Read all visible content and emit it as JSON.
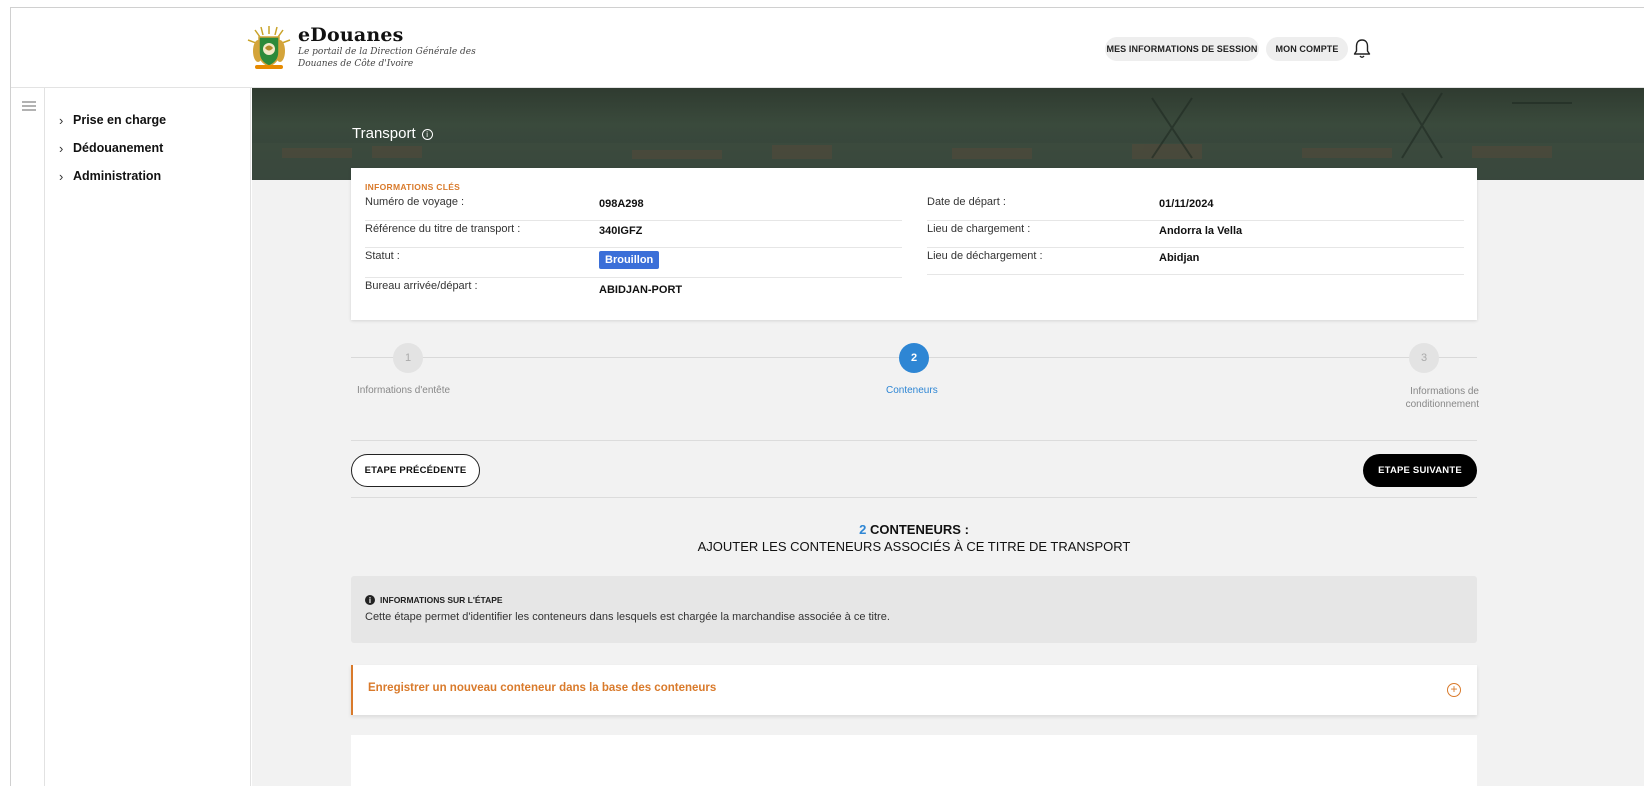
{
  "brand": {
    "name": "eDouanes",
    "tagline": "Le portail de la Direction Générale des Douanes de Côte d'Ivoire"
  },
  "header": {
    "session_label": "MES INFORMATIONS DE SESSION",
    "account_label": "MON COMPTE"
  },
  "sidebar": {
    "items": [
      {
        "label": "Prise en charge"
      },
      {
        "label": "Dédouanement"
      },
      {
        "label": "Administration"
      }
    ]
  },
  "page": {
    "title": "Transport"
  },
  "key_info": {
    "heading": "INFORMATIONS CLÉS",
    "left": [
      {
        "label": "Numéro de voyage :",
        "value": "098A298"
      },
      {
        "label": "Référence du titre de transport :",
        "value": "340IGFZ"
      },
      {
        "label": "Statut :",
        "value": "Brouillon"
      },
      {
        "label": "Bureau arrivée/départ :",
        "value": "ABIDJAN-PORT"
      }
    ],
    "right": [
      {
        "label": "Date de départ :",
        "value": "01/11/2024"
      },
      {
        "label": "Lieu de chargement :",
        "value": "Andorra la Vella"
      },
      {
        "label": "Lieu de déchargement :",
        "value": "Abidjan"
      }
    ],
    "status_color": "#3b6fd8"
  },
  "stepper": {
    "steps": [
      {
        "number": "1",
        "label": "Informations d'entête",
        "state": "inactive"
      },
      {
        "number": "2",
        "label": "Conteneurs",
        "state": "active"
      },
      {
        "number": "3",
        "label": "Informations de conditionnement",
        "state": "inactive"
      }
    ],
    "active_color": "#2e86d4"
  },
  "navigation": {
    "prev_label": "ETAPE PRÉCÉDENTE",
    "next_label": "ETAPE SUIVANTE"
  },
  "section": {
    "count": "2",
    "title_line1": "CONTENEURS :",
    "title_line2": "AJOUTER LES CONTENEURS ASSOCIÉS À CE TITRE DE TRANSPORT"
  },
  "step_info": {
    "heading": "INFORMATIONS SUR L'ÉTAPE",
    "text": "Cette étape permet d'identifier les conteneurs dans lesquels est chargée la marchandise associée à ce titre."
  },
  "accordion": {
    "title": "Enregistrer un nouveau conteneur dans la base des conteneurs",
    "accent_color": "#d97a2b"
  },
  "icons": {
    "menu": "hamburger-icon",
    "bell": "bell-icon",
    "info": "info-icon",
    "plus": "plus-circle-icon",
    "chevron": "chevron-right-icon",
    "emblem": "coat-of-arms-logo"
  }
}
